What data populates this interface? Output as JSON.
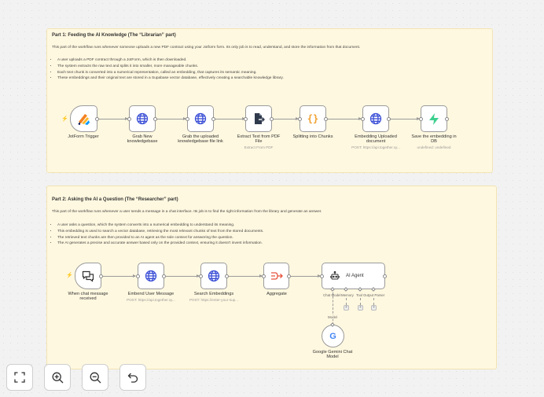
{
  "part1": {
    "title": "Part 1: Feeding the AI Knowledge (The “Librarian” part)",
    "intro": "This part of the workflow runs whenever someone uploads a new PDF contract using your Jotform form. Its only job is to read, understand, and store the information from that document.",
    "bullets": [
      "A user uploads a PDF contract through a JotForm, which is then downloaded.",
      "The system extracts the raw text and splits it into smaller, more manageable chunks.",
      "Each text chunk is converted into a numerical representation, called an embedding, that captures its semantic meaning.",
      "These embeddings and their original text are stored in a Supabase vector database, effectively creating a searchable knowledge library."
    ],
    "nodes": [
      {
        "label": "JotForm Trigger",
        "sub": ""
      },
      {
        "label": "Grab New knowledgebase",
        "sub": ""
      },
      {
        "label": "Grab the uploaded knowledgebase file link",
        "sub": ""
      },
      {
        "label": "Extract Text from PDF File",
        "sub": "Extract From PDF"
      },
      {
        "label": "Splitting into Chunks",
        "sub": ""
      },
      {
        "label": "Embedding Uploaded document",
        "sub": "POST: https://api.together.xy..."
      },
      {
        "label": "Save the embedding in DB",
        "sub": "undefined: undefined"
      }
    ]
  },
  "part2": {
    "title": "Part 2: Asking the AI a Question (The “Researcher” part)",
    "intro": "This part of the workflow runs whenever a user sends a message in a chat interface. Its job is to find the right information from the library and generate an answer.",
    "bullets": [
      "A user asks a question, which the system converts into a numerical embedding to understand its meaning.",
      "This embedding is used to search a vector database, retrieving the most relevant chunks of text from the stored documents.",
      "The retrieved text chunks are then provided to an AI agent as the sole context for answering the question.",
      "The AI generates a precise and accurate answer based only on the provided context, ensuring it doesn't invent information."
    ],
    "nodes": [
      {
        "label": "When chat message received",
        "sub": ""
      },
      {
        "label": "Embend User Message",
        "sub": "POST: https://api.together.xy..."
      },
      {
        "label": "Search Embeddings",
        "sub": "POST: https://enter-your-sup..."
      },
      {
        "label": "Aggregate",
        "sub": ""
      },
      {
        "label": "AI Agent",
        "sub": ""
      },
      {
        "label": "Google Gemini Chat Model",
        "sub": ""
      }
    ],
    "agent_inputs": [
      "Chat Model",
      "Memory",
      "Tool",
      "Output Parser"
    ],
    "model_link_label": "Model",
    "plus": "+"
  },
  "controls": {
    "fit": "fit-view-icon",
    "zoom_in": "zoom-in-icon",
    "zoom_out": "zoom-out-icon",
    "undo": "undo-icon"
  },
  "colors": {
    "note_bg": "#fff8e0",
    "canvas": "#f2f2f2",
    "jotform_orange": "#f48120",
    "jotform_blue": "#0a1551",
    "globe_blue": "#3b4fd6",
    "json_orange": "#f0a030",
    "supabase_green": "#3ecf8e",
    "aggregate_red": "#e8543f"
  }
}
